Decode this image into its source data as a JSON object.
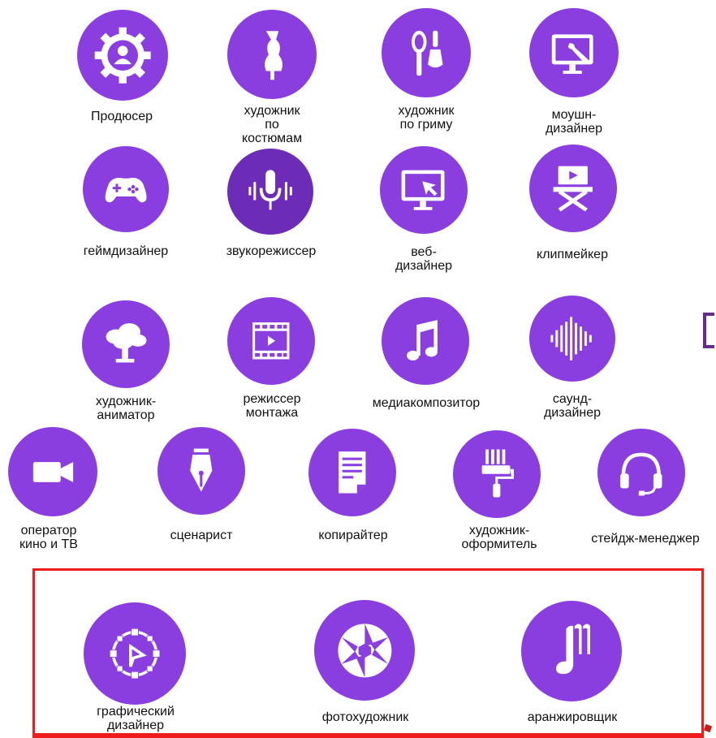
{
  "accent_color": "#8a3ee0",
  "highlight_color": "#ee1c1c",
  "professions": [
    {
      "label": "Продюсер",
      "icon": "producer-gear-icon"
    },
    {
      "label": "художник\nпо\nкостюмам",
      "icon": "mannequin-icon"
    },
    {
      "label": "художник\nпо гриму",
      "icon": "makeup-icon"
    },
    {
      "label": "моушн-\nдизайнер",
      "icon": "monitor-brush-icon"
    },
    {
      "label": "геймдизайнер",
      "icon": "gamepad-icon"
    },
    {
      "label": "звукорежиссер",
      "icon": "microphone-icon"
    },
    {
      "label": "веб-\nдизайнер",
      "icon": "monitor-cursor-icon"
    },
    {
      "label": "клипмейкер",
      "icon": "director-chair-icon"
    },
    {
      "label": "художник-\nаниматор",
      "icon": "animator-tree-icon"
    },
    {
      "label": "режиссер\nмонтажа",
      "icon": "film-strip-icon"
    },
    {
      "label": "медиакомпозитор",
      "icon": "music-note-icon"
    },
    {
      "label": "саунд-\nдизайнер",
      "icon": "sound-wave-icon"
    },
    {
      "label": "оператор\nкино и ТВ",
      "icon": "video-camera-icon"
    },
    {
      "label": "сценарист",
      "icon": "fountain-pen-icon"
    },
    {
      "label": "копирайтер",
      "icon": "document-icon"
    },
    {
      "label": "художник-\nоформитель",
      "icon": "paint-roller-icon"
    },
    {
      "label": "стейдж-менеджер",
      "icon": "headset-icon"
    }
  ],
  "highlighted": [
    {
      "label": "графический\nдизайнер",
      "icon": "vector-design-icon"
    },
    {
      "label": "фотохудожник",
      "icon": "aperture-icon"
    },
    {
      "label": "аранжировщик",
      "icon": "arranger-note-icon"
    }
  ]
}
